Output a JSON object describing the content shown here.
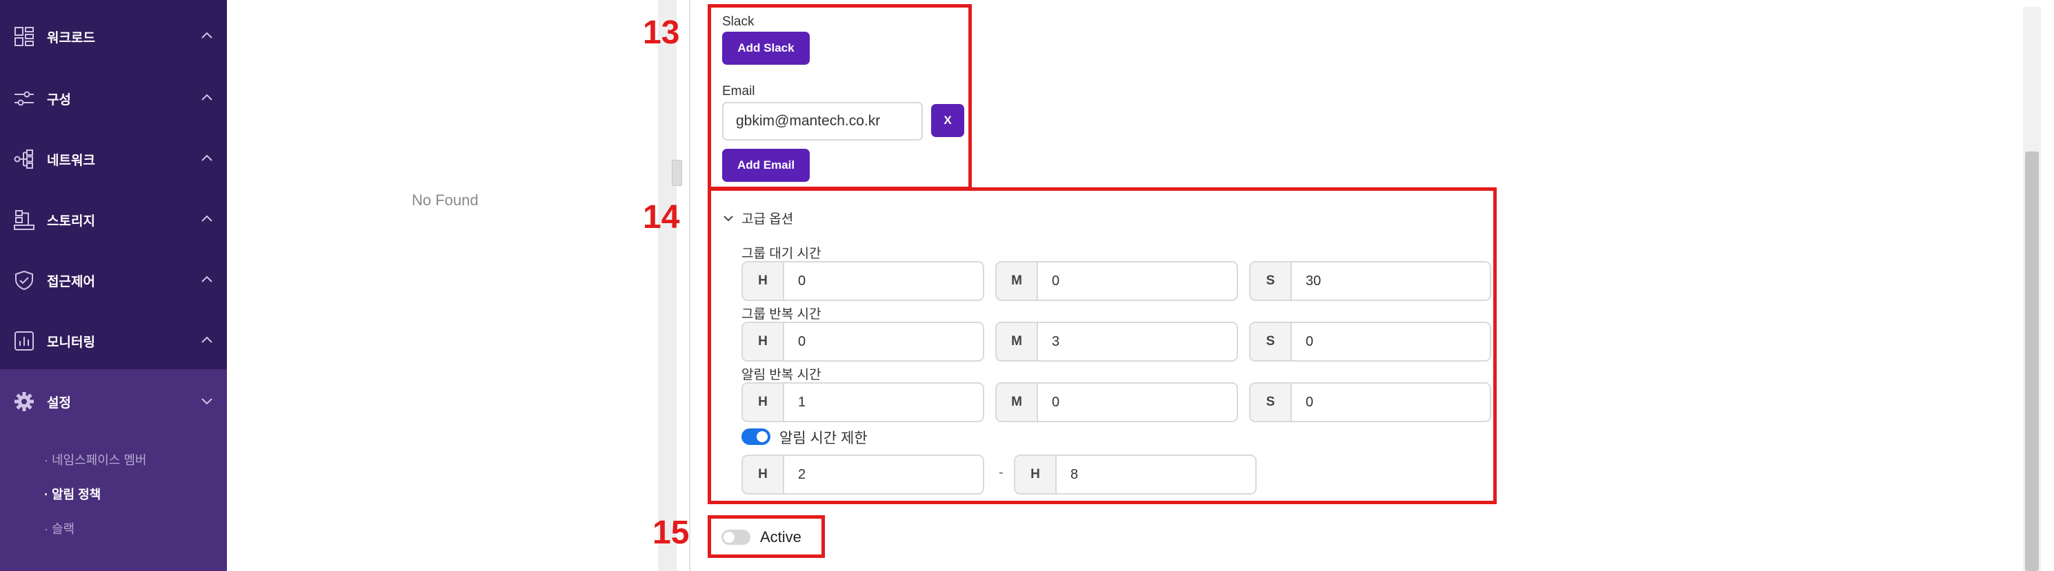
{
  "sidebar": {
    "items": [
      {
        "label": "워크로드",
        "icon": "workload-icon"
      },
      {
        "label": "구성",
        "icon": "config-sliders-icon"
      },
      {
        "label": "네트워크",
        "icon": "network-icon"
      },
      {
        "label": "스토리지",
        "icon": "storage-icon"
      },
      {
        "label": "접근제어",
        "icon": "shield-check-icon"
      },
      {
        "label": "모니터링",
        "icon": "chart-icon"
      },
      {
        "label": "설정",
        "icon": "gear-icon"
      }
    ],
    "sub_items": [
      {
        "label": "· 네임스페이스 멤버",
        "active": false
      },
      {
        "label": "· 알림 정책",
        "active": true
      },
      {
        "label": "· 슬랙",
        "active": false
      }
    ]
  },
  "left_panel": {
    "empty_text": "No Found"
  },
  "annotations": {
    "n13": "13",
    "n14": "14",
    "n15": "15",
    "color": "#e31b1b"
  },
  "form": {
    "slack_label": "Slack",
    "add_slack": "Add Slack",
    "email_label": "Email",
    "email_value": "gbkim@mantech.co.kr",
    "remove_email": "X",
    "add_email": "Add Email",
    "advanced_label": "고급 옵션",
    "group_wait": {
      "label": "그룹 대기 시간",
      "h_tag": "H",
      "m_tag": "M",
      "s_tag": "S",
      "h": "0",
      "m": "0",
      "s": "30"
    },
    "group_repeat": {
      "label": "그룹 반복 시간",
      "h_tag": "H",
      "m_tag": "M",
      "s_tag": "S",
      "h": "0",
      "m": "3",
      "s": "0"
    },
    "alert_repeat": {
      "label": "알림 반복 시간",
      "h_tag": "H",
      "m_tag": "M",
      "s_tag": "S",
      "h": "1",
      "m": "0",
      "s": "0"
    },
    "time_limit": {
      "label": "알림 시간 제한",
      "enabled": true,
      "from_tag": "H",
      "from": "2",
      "separator": "-",
      "to_tag": "H",
      "to": "8"
    },
    "active": {
      "label": "Active",
      "enabled": false
    }
  },
  "colors": {
    "sidebar_bg": "#2f1c5c",
    "accent": "#5b21b6",
    "toggle_on": "#1a73e8"
  }
}
